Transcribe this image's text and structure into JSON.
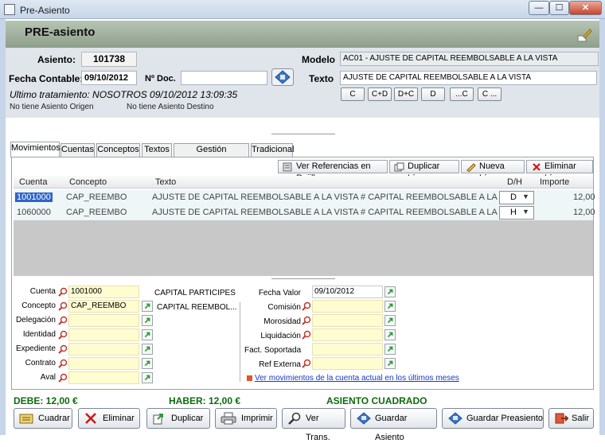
{
  "window": {
    "title": "Pre-Asiento",
    "minimize": "—",
    "maximize": "☐",
    "close": "✕"
  },
  "header": {
    "title": "PRE-asiento"
  },
  "info": {
    "asiento_label": "Asiento:",
    "asiento_value": "101738",
    "fecha_label": "Fecha Contable:",
    "fecha_value": "09/10/2012",
    "ndoc_label": "Nº Doc.",
    "ndoc_value": "",
    "modelo_label": "Modelo",
    "modelo_value": "AC01 - AJUSTE DE CAPITAL REEMBOLSABLE A LA VISTA",
    "texto_label": "Texto",
    "texto_value": "AJUSTE DE CAPITAL REEMBOLSABLE A LA VISTA",
    "ultimo": "Ultimo tratamiento: NOSOTROS 09/10/2012 13:09:35",
    "origen": "No tiene Asiento Origen",
    "destino": "No tiene Asiento Destino",
    "text_buttons": [
      "C",
      "C+D",
      "D+C",
      "D",
      "...C",
      "C ..."
    ]
  },
  "tabs": [
    "Movimientos",
    "Cuentas",
    "Conceptos",
    "Textos",
    "Gestión documental",
    "Tradicional"
  ],
  "toolbar": {
    "ver_ref": "Ver Referencias en Rejilla",
    "duplicar": "Duplicar Línea",
    "nueva": "Nueva Línea",
    "eliminar": "Eliminar Línea"
  },
  "grid": {
    "headers": [
      "Cuenta",
      "Concepto",
      "Texto",
      "D/H",
      "Importe"
    ],
    "rows": [
      {
        "cuenta": "1001000",
        "concepto": "CAP_REEMBO",
        "texto": "AJUSTE DE CAPITAL REEMBOLSABLE A LA VISTA # CAPITAL REEMBOLSABLE A LA VISTA",
        "dh": "D",
        "importe": "12,00"
      },
      {
        "cuenta": "1060000",
        "concepto": "CAP_REEMBO",
        "texto": "AJUSTE DE CAPITAL REEMBOLSABLE A LA VISTA # CAPITAL REEMBOLSABLE A LA VISTA",
        "dh": "H",
        "importe": "12,00"
      }
    ]
  },
  "form": {
    "cuenta_label": "Cuenta",
    "cuenta_value": "1001000",
    "cuenta_desc": "CAPITAL PARTICIPES",
    "concepto_label": "Concepto",
    "concepto_value": "CAP_REEMBO",
    "concepto_desc": "CAPITAL REEMBOL...",
    "delegacion_label": "Delegación",
    "identidad_label": "Identidad",
    "expediente_label": "Expediente",
    "contrato_label": "Contrato",
    "aval_label": "Aval",
    "fecha_valor_label": "Fecha Valor",
    "fecha_valor_value": "09/10/2012",
    "comision_label": "Comisión",
    "morosidad_label": "Morosidad",
    "liquidacion_label": "Liquidación",
    "fact_label": "Fact. Soportada",
    "ref_label": "Ref Externa",
    "link": "Ver movimientos de la cuenta actual en los últimos meses"
  },
  "totals": {
    "debe": "DEBE: 12,00 €",
    "haber": "HABER: 12,00 €",
    "estado": "ASIENTO CUADRADO"
  },
  "buttons": {
    "cuadrar": "Cuadrar",
    "eliminar": "Eliminar",
    "duplicar": "Duplicar",
    "imprimir": "Imprimir",
    "ver_trans": "Ver Trans.",
    "guardar_asiento": "Guardar Asiento",
    "guardar_preasiento": "Guardar Preasiento",
    "salir": "Salir"
  },
  "colors": {
    "header_band": "#9aaa97",
    "totals_green": "#0d6a0d",
    "grid_row": "#eef6f8",
    "yellow_field": "#fffcd0",
    "link": "#1a37c5"
  },
  "icons": [
    "app-icon",
    "brush-icon",
    "save-icon",
    "doc-icon",
    "copy-icon",
    "pencil-icon",
    "delete-x-icon",
    "magnifier-icon",
    "go-arrow-icon",
    "printer-icon",
    "exit-icon",
    "disk-icon"
  ]
}
